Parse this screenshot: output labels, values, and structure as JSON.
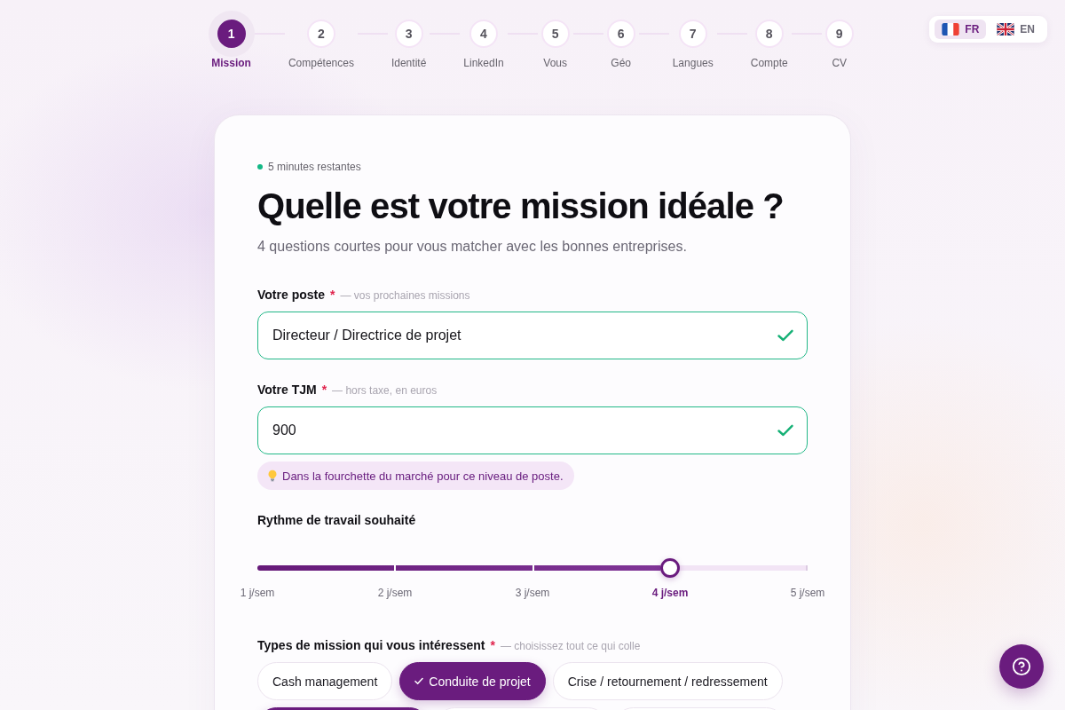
{
  "steps": [
    {
      "number": "1",
      "label": "Mission",
      "selected": true
    },
    {
      "number": "2",
      "label": "Compétences",
      "selected": false
    },
    {
      "number": "3",
      "label": "Identité",
      "selected": false
    },
    {
      "number": "4",
      "label": "LinkedIn",
      "selected": false
    },
    {
      "number": "5",
      "label": "Vous",
      "selected": false
    },
    {
      "number": "6",
      "label": "Géo",
      "selected": false
    },
    {
      "number": "7",
      "label": "Langues",
      "selected": false
    },
    {
      "number": "8",
      "label": "Compte",
      "selected": false
    },
    {
      "number": "9",
      "label": "CV",
      "selected": false
    }
  ],
  "language_switch": [
    {
      "code": "FR",
      "kind": "france",
      "selected": true
    },
    {
      "code": "EN",
      "kind": "uk",
      "selected": false
    }
  ],
  "card": {
    "timer": "5 minutes restantes",
    "title": "Quelle est votre mission idéale ?",
    "subtitle": "4 questions courtes pour vous matcher avec les bonnes entreprises.",
    "fields": [
      {
        "label": "Votre poste",
        "required_mark": "*",
        "hint": "— vos prochaines missions",
        "value": "Directeur / Directrice de projet",
        "valid": true
      },
      {
        "label": "Votre TJM",
        "required_mark": "*",
        "hint": "— hors taxe, en euros",
        "value": "900",
        "valid": true,
        "note": "Dans la fourchette du marché pour ce niveau de poste."
      }
    ],
    "work_rhythm": {
      "label": "Rythme de travail souhaité",
      "level": 0.75,
      "stops": [
        {
          "label": "1 j/sem",
          "selected": false
        },
        {
          "label": "2 j/sem",
          "selected": false
        },
        {
          "label": "3 j/sem",
          "selected": false
        },
        {
          "label": "4 j/sem",
          "selected": true
        },
        {
          "label": "5 j/sem",
          "selected": false
        }
      ]
    },
    "mission_types": {
      "label": "Types de mission qui vous intéressent",
      "required_mark": "*",
      "hint": "— choisissez tout ce qui colle",
      "chips": [
        {
          "label": "Cash management",
          "selected": false
        },
        {
          "label": "Conduite de projet",
          "selected": true
        },
        {
          "label": "Crise / retournement / redressement",
          "selected": false
        },
        {
          "selected": true
        },
        {
          "selected": false
        },
        {
          "selected": false
        }
      ]
    }
  }
}
